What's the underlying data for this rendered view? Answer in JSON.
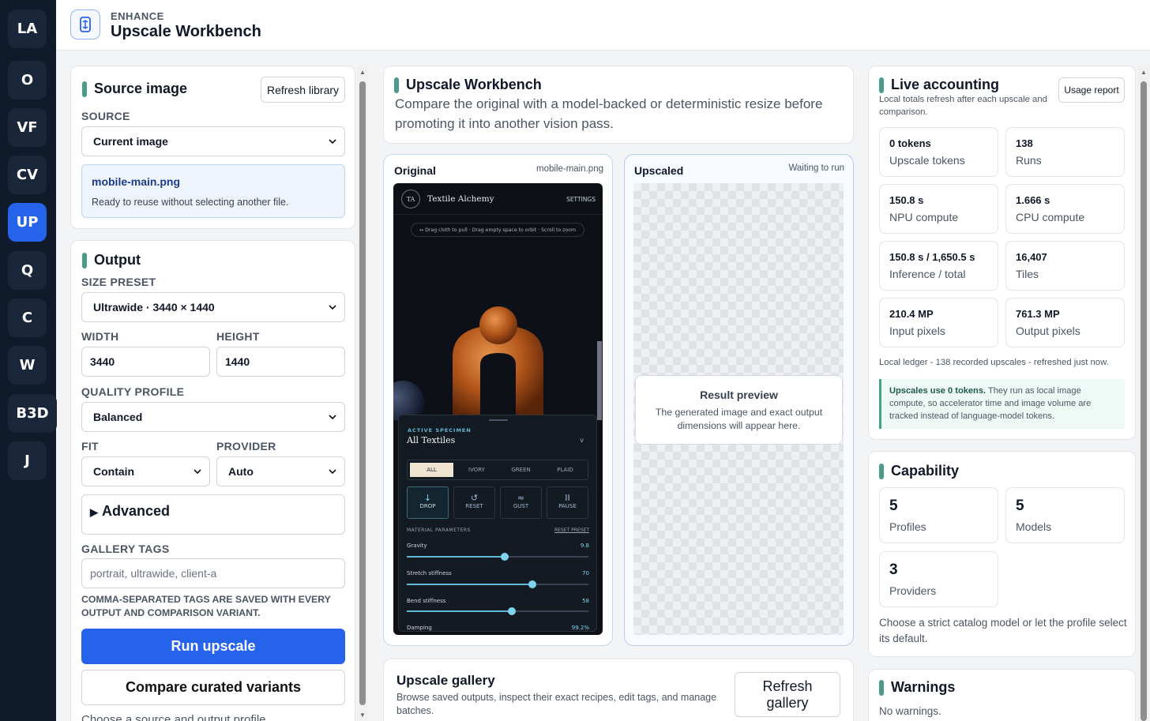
{
  "rail": {
    "items": [
      "LA",
      "O",
      "VF",
      "CV",
      "UP",
      "Q",
      "C",
      "W",
      "B3D",
      "J"
    ],
    "active": "UP"
  },
  "header": {
    "eyebrow": "ENHANCE",
    "title": "Upscale Workbench"
  },
  "source": {
    "heading": "Source image",
    "refresh_label": "Refresh library",
    "source_label": "SOURCE",
    "source_value": "Current image",
    "file_name": "mobile-main.png",
    "file_note": "Ready to reuse without selecting another file."
  },
  "output": {
    "heading": "Output",
    "size_preset_label": "SIZE PRESET",
    "size_preset_value": "Ultrawide · 3440 × 1440",
    "width_label": "WIDTH",
    "width_value": "3440",
    "height_label": "HEIGHT",
    "height_value": "1440",
    "quality_label": "QUALITY PROFILE",
    "quality_value": "Balanced",
    "fit_label": "FIT",
    "fit_value": "Contain",
    "provider_label": "PROVIDER",
    "provider_value": "Auto",
    "advanced_label": "Advanced",
    "tags_label": "GALLERY TAGS",
    "tags_placeholder": "portrait, ultrawide, client-a",
    "tags_help": "COMMA-SEPARATED TAGS ARE SAVED WITH EVERY OUTPUT AND COMPARISON VARIANT.",
    "run_label": "Run upscale",
    "compare_label": "Compare curated variants",
    "footer_hint": "Choose a source and output profile"
  },
  "workbench": {
    "title": "Upscale Workbench",
    "description": "Compare the original with a model-backed or deterministic resize before promoting it into another vision pass.",
    "original_label": "Original",
    "original_file": "mobile-main.png",
    "upscaled_label": "Upscaled",
    "upscaled_status": "Waiting to run",
    "result_title": "Result preview",
    "result_desc": "The generated image and exact output dimensions will appear here."
  },
  "preview_app": {
    "avatar": "TA",
    "brand": "Textile Alchemy",
    "settings": "SETTINGS",
    "hint": "↔  Drag cloth to pull · Drag empty space to orbit · Scroll to zoom",
    "specimen_label": "ACTIVE SPECIMEN",
    "specimen_value": "All Textiles",
    "specimen_toggle": "v",
    "filters": [
      "ALL",
      "IVORY",
      "GREEN",
      "PLAID"
    ],
    "tools": [
      {
        "glyph": "↓",
        "label": "DROP"
      },
      {
        "glyph": "↺",
        "label": "RESET"
      },
      {
        "glyph": "≈",
        "label": "GUST"
      },
      {
        "glyph": "II",
        "label": "PAUSE"
      }
    ],
    "params_label": "MATERIAL PARAMETERS",
    "reset_preset": "RESET PRESET",
    "params": [
      {
        "name": "Gravity",
        "value": "9.8",
        "level": 0.54
      },
      {
        "name": "Stretch stiffness",
        "value": "70",
        "level": 0.69
      },
      {
        "name": "Bend stiffness",
        "value": "58",
        "level": 0.58
      },
      {
        "name": "Damping",
        "value": "99.2%",
        "level": 0.99
      }
    ]
  },
  "gallery": {
    "title": "Upscale gallery",
    "desc": "Browse saved outputs, inspect their exact recipes, edit tags, and manage batches.",
    "refresh_label": "Refresh gallery"
  },
  "accounting": {
    "title": "Live accounting",
    "subtitle": "Local totals refresh after each upscale and comparison.",
    "report_label": "Usage report",
    "stats": [
      {
        "value": "0 tokens",
        "label": "Upscale tokens"
      },
      {
        "value": "138",
        "label": "Runs"
      },
      {
        "value": "150.8 s",
        "label": "NPU compute"
      },
      {
        "value": "1.666 s",
        "label": "CPU compute"
      },
      {
        "value": "150.8 s / 1,650.5 s",
        "label": "Inference / total"
      },
      {
        "value": "16,407",
        "label": "Tiles"
      },
      {
        "value": "210.4 MP",
        "label": "Input pixels"
      },
      {
        "value": "761.3 MP",
        "label": "Output pixels"
      }
    ],
    "ledger": "Local ledger - 138 recorded upscales - refreshed just now.",
    "note_bold": "Upscales use 0 tokens.",
    "note_rest": " They run as local image compute, so accelerator time and image volume are tracked instead of language-model tokens."
  },
  "capability": {
    "title": "Capability",
    "items": [
      {
        "value": "5",
        "label": "Profiles"
      },
      {
        "value": "5",
        "label": "Models"
      },
      {
        "value": "3",
        "label": "Providers"
      }
    ],
    "desc": "Choose a strict catalog model or let the profile select its default."
  },
  "warnings": {
    "title": "Warnings",
    "text": "No warnings."
  },
  "colors": {
    "accent": "#2563eb",
    "teal": "#4c9a8e",
    "rail": "#0f1a2b"
  }
}
